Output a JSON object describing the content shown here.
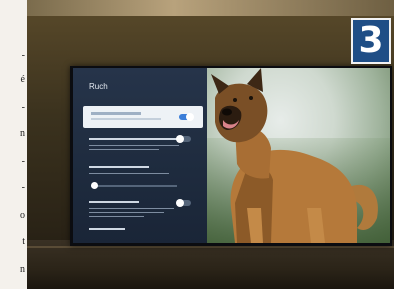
{
  "badge_number": "3",
  "left_text_fragments": [
    "-",
    "é",
    "-",
    "n",
    "-",
    "-",
    "o",
    "t",
    "n"
  ],
  "settings": {
    "title": "Ruch"
  }
}
